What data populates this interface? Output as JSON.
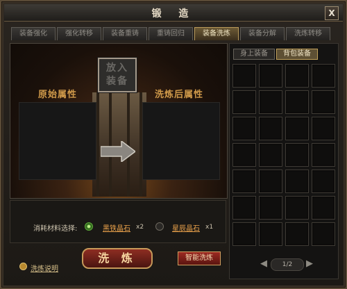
{
  "window": {
    "title": "锻 造",
    "close_label": "X"
  },
  "tabs": [
    {
      "label": "装备强化",
      "active": false
    },
    {
      "label": "强化转移",
      "active": false
    },
    {
      "label": "装备重铸",
      "active": false
    },
    {
      "label": "重铸回归",
      "active": false
    },
    {
      "label": "装备洗炼",
      "active": true
    },
    {
      "label": "装备分解",
      "active": false
    },
    {
      "label": "洗炼转移",
      "active": false
    }
  ],
  "wash": {
    "slot_text": "放入装备",
    "original_label": "原始属性",
    "after_label": "洗炼后属性"
  },
  "materials": {
    "label": "消耗材料选择:",
    "options": [
      {
        "name": "黑铁晶石",
        "qty": "x2",
        "selected": true
      },
      {
        "name": "星辰晶石",
        "qty": "x1",
        "selected": false
      }
    ]
  },
  "buttons": {
    "wash": "洗 炼",
    "smart": "智能洗炼"
  },
  "help": {
    "label": "洗炼说明"
  },
  "inventory": {
    "tabs": [
      {
        "label": "身上装备",
        "active": false
      },
      {
        "label": "背包装备",
        "active": true
      }
    ],
    "rows": 7,
    "cols": 4,
    "page": "1/2"
  },
  "colors": {
    "accent": "#d09a4a",
    "button_red": "#8e2d22",
    "selected_radio": "#5fae3a"
  }
}
